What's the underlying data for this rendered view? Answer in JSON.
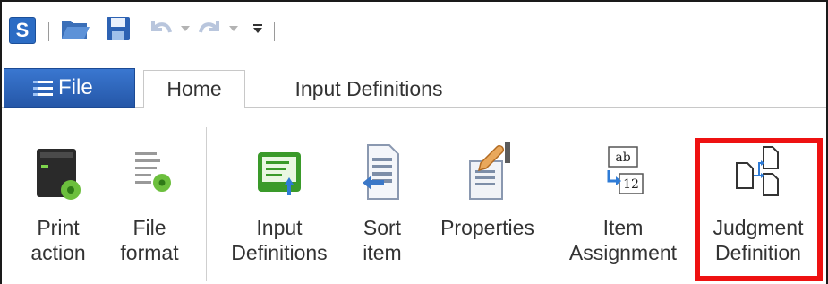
{
  "quick_access": {
    "app_icon_letter": "S",
    "icons": [
      "app-icon",
      "open-folder-icon",
      "save-icon",
      "undo-icon",
      "redo-icon",
      "customize-toolbar-icon"
    ]
  },
  "tabs": {
    "file": "File",
    "home": "Home",
    "input_definitions": "Input Definitions"
  },
  "ribbon": {
    "buttons": [
      {
        "line1": "Print",
        "line2": "action",
        "icon": "print-action-icon"
      },
      {
        "line1": "File",
        "line2": "format",
        "icon": "file-format-icon"
      },
      {
        "line1": "Input",
        "line2": "Definitions",
        "icon": "input-definitions-icon"
      },
      {
        "line1": "Sort",
        "line2": "item",
        "icon": "sort-item-icon"
      },
      {
        "line1": "Properties",
        "line2": "",
        "icon": "properties-icon"
      },
      {
        "line1": "Item",
        "line2": "Assignment",
        "icon": "item-assignment-icon"
      },
      {
        "line1": "Judgment",
        "line2": "Definition",
        "icon": "judgment-definition-icon"
      }
    ],
    "item_assignment_icon_text": {
      "top": "ab",
      "bottom": "12"
    }
  },
  "colors": {
    "accent": "#2b6cc4",
    "highlight": "#ee1111",
    "green": "#3f9a2a"
  }
}
